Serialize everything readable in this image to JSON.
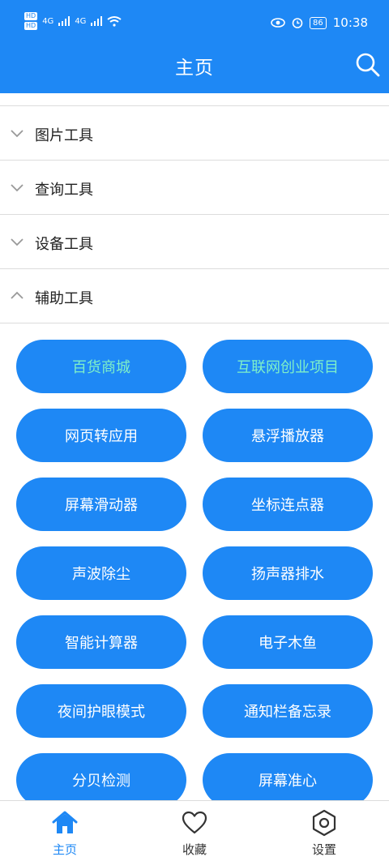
{
  "status_bar": {
    "hd1": "HD",
    "hd2": "HD",
    "net1": "4G",
    "net2": "4G",
    "battery": "86",
    "time": "10:38"
  },
  "header": {
    "title": "主页",
    "search_icon": "search-icon"
  },
  "groups": [
    {
      "label": "图片工具",
      "expanded": false
    },
    {
      "label": "查询工具",
      "expanded": false
    },
    {
      "label": "设备工具",
      "expanded": false
    },
    {
      "label": "辅助工具",
      "expanded": true
    }
  ],
  "tools": [
    {
      "label": "百货商城",
      "accent": true
    },
    {
      "label": "互联网创业项目",
      "accent": true
    },
    {
      "label": "网页转应用"
    },
    {
      "label": "悬浮播放器"
    },
    {
      "label": "屏幕滑动器"
    },
    {
      "label": "坐标连点器"
    },
    {
      "label": "声波除尘"
    },
    {
      "label": "扬声器排水"
    },
    {
      "label": "智能计算器"
    },
    {
      "label": "电子木鱼"
    },
    {
      "label": "夜间护眼模式"
    },
    {
      "label": "通知栏备忘录"
    },
    {
      "label": "分贝检测"
    },
    {
      "label": "屏幕准心"
    }
  ],
  "bottom_nav": [
    {
      "label": "主页",
      "icon": "home-icon",
      "active": true
    },
    {
      "label": "收藏",
      "icon": "heart-icon"
    },
    {
      "label": "设置",
      "icon": "settings-icon"
    }
  ],
  "colors": {
    "primary": "#1e88f5",
    "accent_text": "#7ff0c8",
    "divider": "#dcdcdc"
  }
}
